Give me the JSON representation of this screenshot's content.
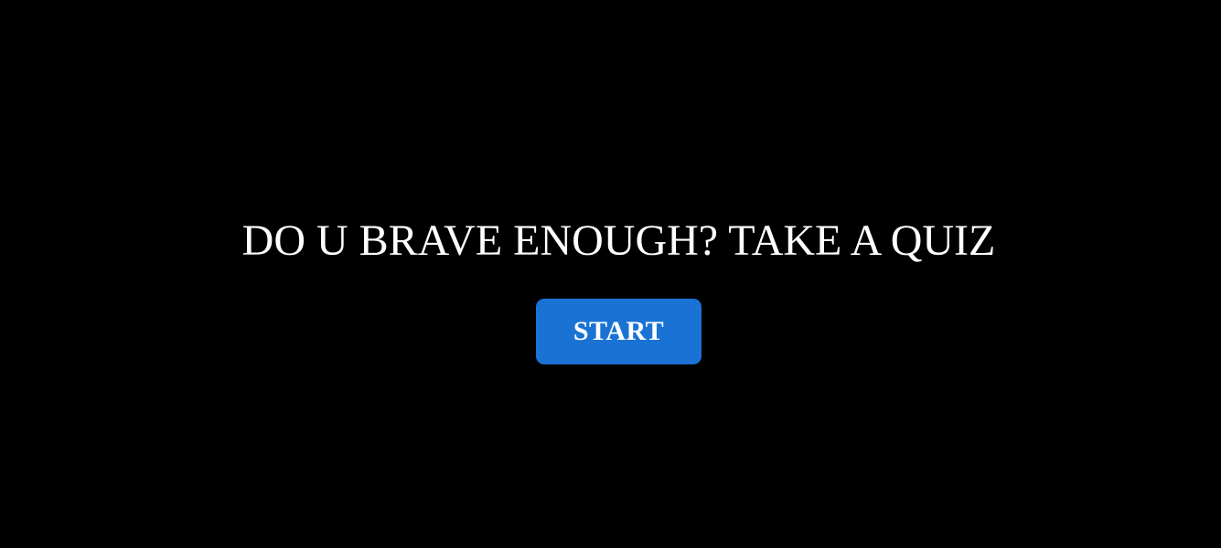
{
  "title": "DO U BRAVE ENOUGH? TAKE A QUIZ",
  "start_button": {
    "label": "START"
  },
  "colors": {
    "background": "#000000",
    "text": "#ffffff",
    "button": "#1a73d4"
  }
}
